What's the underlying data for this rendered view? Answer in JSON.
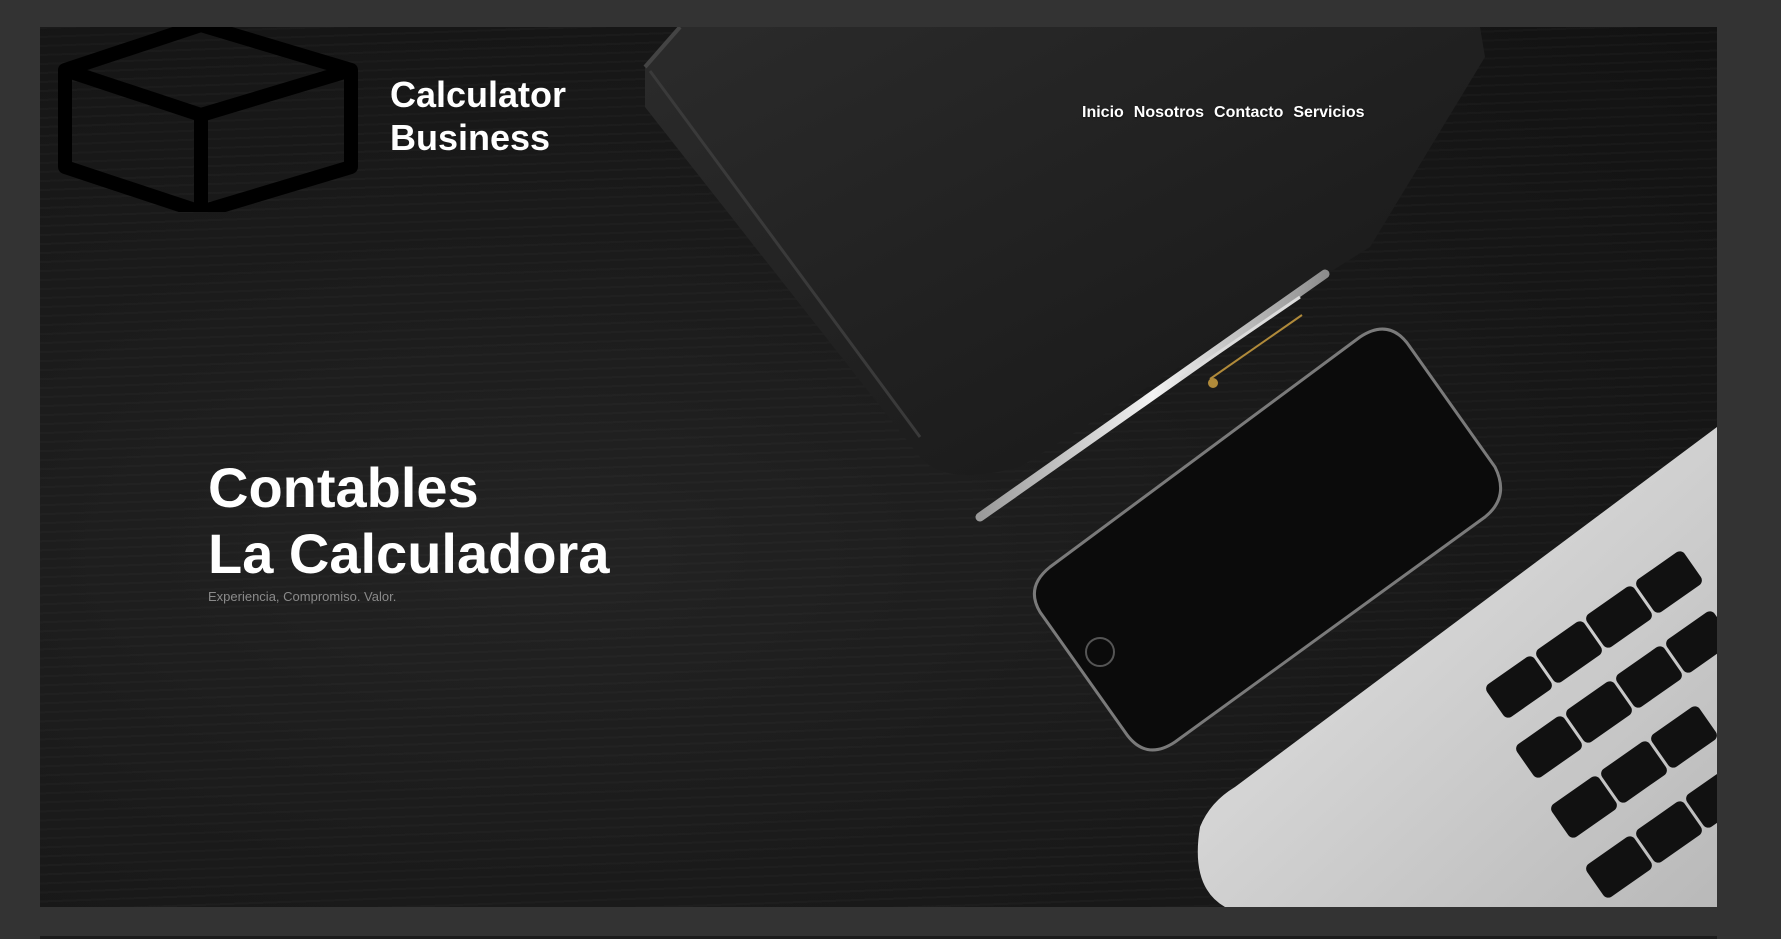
{
  "brand": {
    "line1": "Calculator",
    "line2": "Business",
    "logo_icon": "box-icon"
  },
  "nav": {
    "items": [
      "Inicio",
      "Nosotros",
      "Contacto",
      "Servicios"
    ]
  },
  "hero": {
    "title_line1": "Contables",
    "title_line2": "La Calculadora",
    "tagline": "Experiencia, Compromiso. Valor."
  },
  "colors": {
    "page_background": "#333333",
    "hero_background": "#1a1a1a",
    "text": "#ffffff",
    "tagline": "#8a8a8a"
  }
}
